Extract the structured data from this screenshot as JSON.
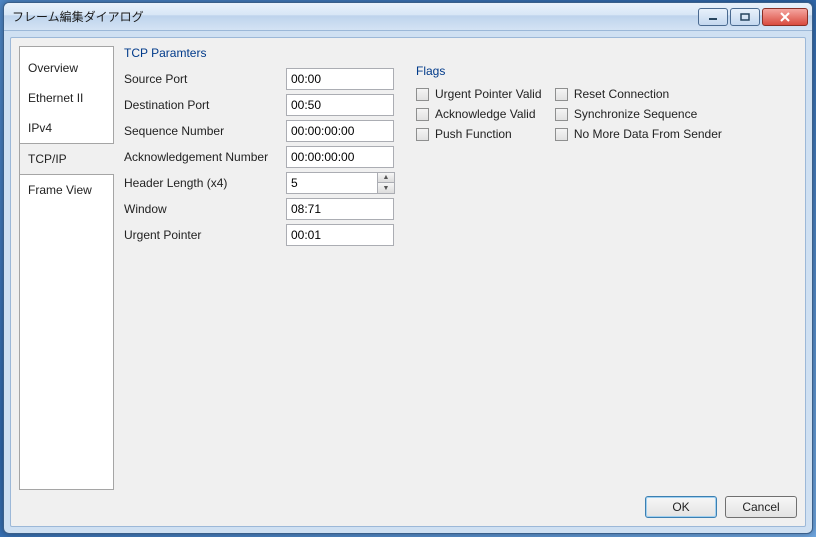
{
  "window": {
    "title": "フレーム編集ダイアログ"
  },
  "tabs": {
    "items": [
      {
        "label": "Overview"
      },
      {
        "label": "Ethernet II"
      },
      {
        "label": "IPv4"
      },
      {
        "label": "TCP/IP"
      },
      {
        "label": "Frame View"
      }
    ],
    "selected_index": 3
  },
  "panel": {
    "group_label": "TCP Paramters",
    "rows": {
      "source_port": {
        "label": "Source Port",
        "value": "00:00"
      },
      "destination_port": {
        "label": "Destination Port",
        "value": "00:50"
      },
      "sequence_number": {
        "label": "Sequence Number",
        "value": "00:00:00:00"
      },
      "ack_number": {
        "label": "Acknowledgement Number",
        "value": "00:00:00:00"
      },
      "header_length": {
        "label": "Header Length (x4)",
        "value": "5"
      },
      "window": {
        "label": "Window",
        "value": "08:71"
      },
      "urgent_pointer": {
        "label": "Urgent Pointer",
        "value": "00:01"
      }
    },
    "flags": {
      "group_label": "Flags",
      "left": [
        {
          "label": "Urgent Pointer Valid",
          "checked": false
        },
        {
          "label": "Acknowledge Valid",
          "checked": false
        },
        {
          "label": "Push Function",
          "checked": false
        }
      ],
      "right": [
        {
          "label": "Reset Connection",
          "checked": false
        },
        {
          "label": "Synchronize Sequence",
          "checked": false
        },
        {
          "label": "No More Data From Sender",
          "checked": false
        }
      ]
    }
  },
  "buttons": {
    "ok": "OK",
    "cancel": "Cancel"
  }
}
